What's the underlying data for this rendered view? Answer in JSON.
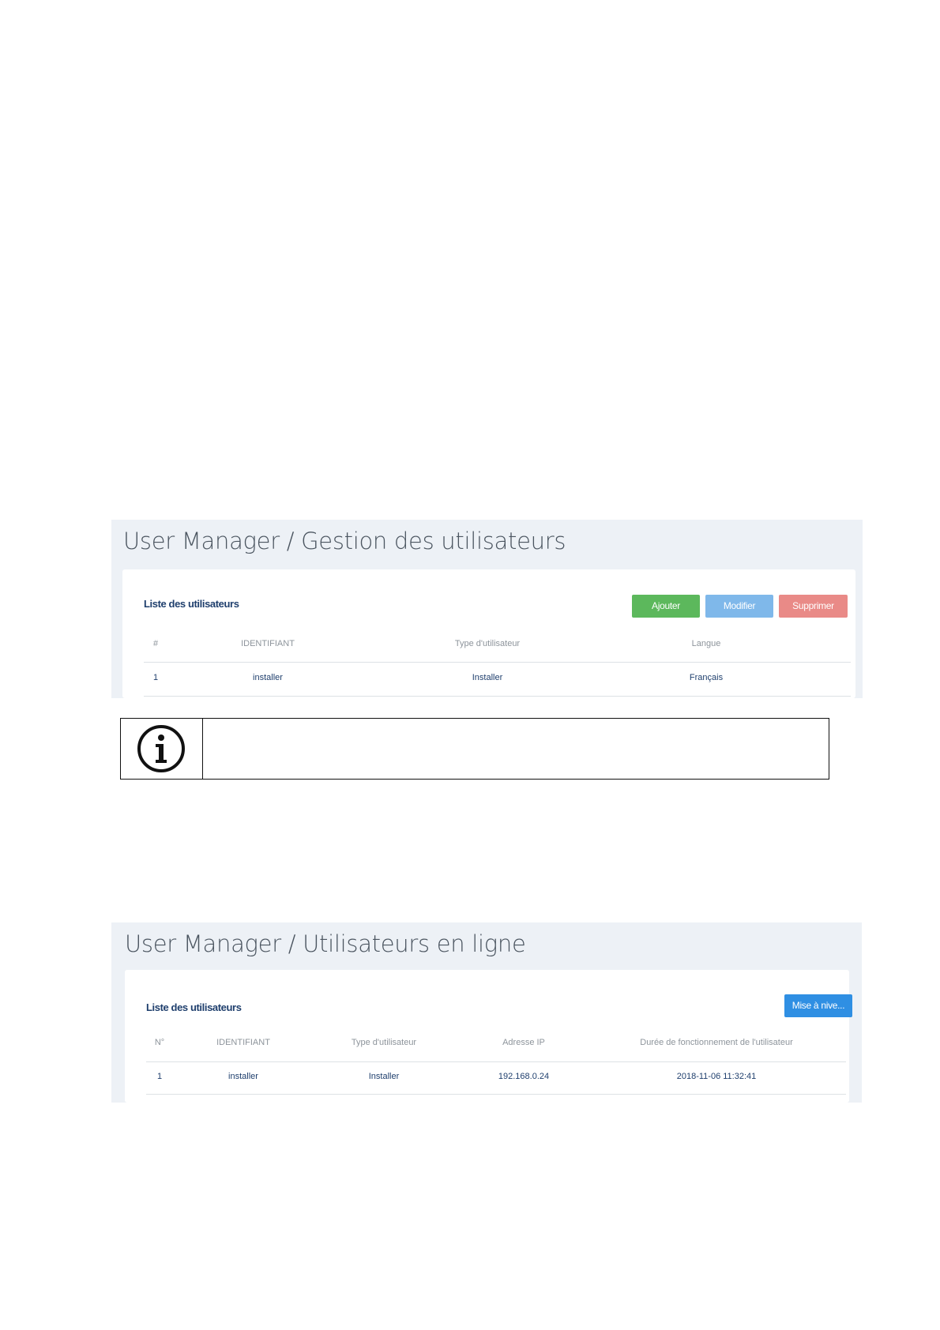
{
  "shot1": {
    "title": "User Manager / Gestion des utilisateurs",
    "card_title": "Liste des utilisateurs",
    "buttons": {
      "add": "Ajouter",
      "edit": "Modifier",
      "delete": "Supprimer"
    },
    "columns": [
      "#",
      "IDENTIFIANT",
      "Type d'utilisateur",
      "Langue"
    ],
    "rows": [
      [
        "1",
        "installer",
        "Installer",
        "Français"
      ]
    ],
    "colors": {
      "add": "#5cb85c",
      "edit": "#7fb8ea",
      "delete": "#e98a87"
    }
  },
  "info_box": {
    "icon": "info-circle-icon"
  },
  "shot2": {
    "title": "User Manager / Utilisateurs en ligne",
    "card_title": "Liste des utilisateurs",
    "buttons": {
      "upgrade": "Mise à nive..."
    },
    "columns": [
      "N°",
      "IDENTIFIANT",
      "Type d'utilisateur",
      "Adresse IP",
      "Durée de fonctionnement de l'utilisateur"
    ],
    "rows": [
      [
        "1",
        "installer",
        "Installer",
        "192.168.0.24",
        "2018-11-06 11:32:41"
      ]
    ],
    "colors": {
      "upgrade": "#2f8fe3"
    }
  }
}
